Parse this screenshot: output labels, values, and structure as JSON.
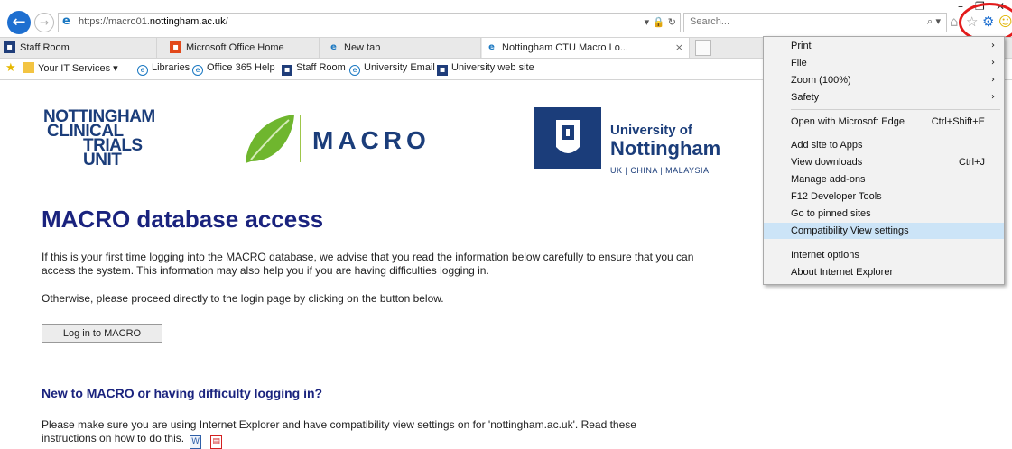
{
  "browser": {
    "url_host": "https://macro01.",
    "url_domain": "nottingham.ac.uk",
    "url_path": "/",
    "url_tools": "▾ 🔒 ↻",
    "search_placeholder": "Search...",
    "search_icon": "⌕ ▾",
    "window_controls": {
      "minimize": "–",
      "restore": "❐",
      "close": "✕"
    },
    "toolbar_icons": {
      "home": "⌂",
      "favorites": "☆",
      "tools": "⚙",
      "feedback": "☺"
    },
    "tabs": [
      {
        "label": "Staff Room",
        "favicon": "university-logo"
      },
      {
        "label": "Microsoft Office Home",
        "favicon": "office-logo"
      },
      {
        "label": "New tab",
        "favicon": "ie-logo"
      },
      {
        "label": "Nottingham CTU Macro Lo...",
        "favicon": "ie-logo",
        "close": "×"
      }
    ],
    "favorites_bar": [
      {
        "label": "Your IT Services ▾",
        "icon": "folder-icon"
      },
      {
        "label": "Libraries",
        "icon": "ie-icon"
      },
      {
        "label": "Office 365 Help",
        "icon": "ie-icon"
      },
      {
        "label": "Staff Room",
        "icon": "university-icon"
      },
      {
        "label": "University Email",
        "icon": "ie-icon"
      },
      {
        "label": "University web site",
        "icon": "university-icon"
      }
    ]
  },
  "page": {
    "logos": {
      "nctu": [
        "NOTTINGHAM",
        "CLINICAL",
        "TRIALS",
        "UNIT"
      ],
      "macro": "MACRO",
      "university": {
        "line1": "University of",
        "line2": "Nottingham",
        "line3": "UK | CHINA | MALAYSIA"
      }
    },
    "title": "MACRO database access",
    "intro": "If this is your first time logging into the MACRO database, we advise that you read the information below carefully to ensure that you can access the system. This information may also help you if you are having difficulties logging in.",
    "proceed": "Otherwise, please proceed directly to the login page by clicking on the button below.",
    "login_button": "Log in to MACRO",
    "subheading": "New to MACRO or having difficulty logging in?",
    "instructions": "Please make sure you are using Internet Explorer and have compatibility view settings on for 'nottingham.ac.uk'. Read these instructions on how to do this."
  },
  "tools_menu": {
    "items": [
      {
        "label": "Print",
        "submenu": true
      },
      {
        "label": "File",
        "submenu": true
      },
      {
        "label": "Zoom (100%)",
        "submenu": true
      },
      {
        "label": "Safety",
        "submenu": true
      },
      {
        "label": "Open with Microsoft Edge",
        "shortcut": "Ctrl+Shift+E"
      },
      {
        "label": "Add site to Apps"
      },
      {
        "label": "View downloads",
        "shortcut": "Ctrl+J"
      },
      {
        "label": "Manage add-ons"
      },
      {
        "label": "F12 Developer Tools"
      },
      {
        "label": "Go to pinned sites"
      },
      {
        "label": "Compatibility View settings",
        "highlighted": true
      },
      {
        "label": "Internet options"
      },
      {
        "label": "About Internet Explorer"
      }
    ],
    "submenu_arrow": "›"
  },
  "colors": {
    "heading": "#1a237e",
    "logo_navy": "#1b3d7a",
    "menu_highlight": "#cce4f7",
    "annotation_ring": "#e31b1b"
  }
}
